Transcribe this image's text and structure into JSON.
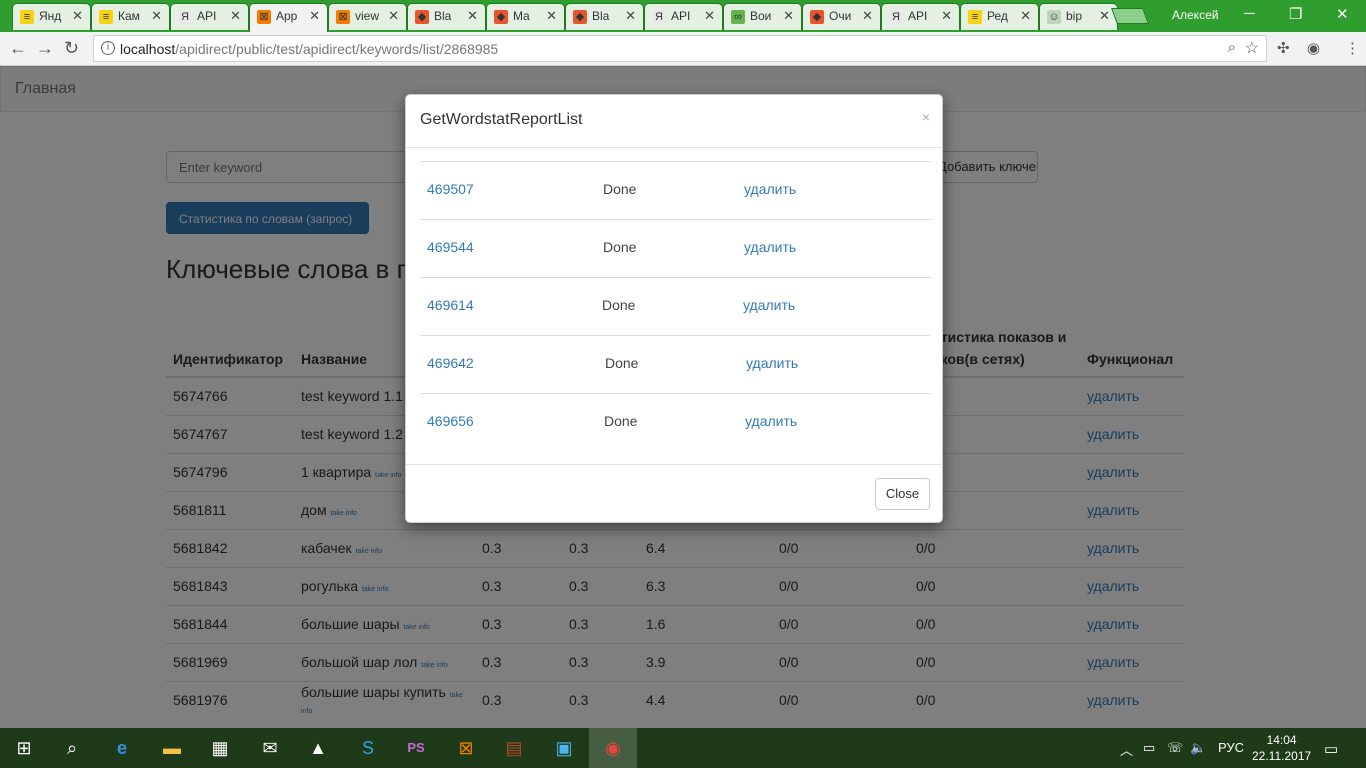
{
  "browser": {
    "tabs": [
      {
        "title": "Янд",
        "fav_color": "#f5d312",
        "fav_text": "≡"
      },
      {
        "title": "Кам",
        "fav_color": "#f5d312",
        "fav_text": "≡"
      },
      {
        "title": "API",
        "fav_color": "#e9e9e9",
        "fav_text": "Я"
      },
      {
        "title": "App",
        "fav_color": "#f57c00",
        "fav_text": "⊠"
      },
      {
        "title": "view",
        "fav_color": "#f57c00",
        "fav_text": "⊠"
      },
      {
        "title": "Bla",
        "fav_color": "#e8542c",
        "fav_text": "◆"
      },
      {
        "title": "Ma",
        "fav_color": "#e8542c",
        "fav_text": "◆"
      },
      {
        "title": "Bla",
        "fav_color": "#e8542c",
        "fav_text": "◆"
      },
      {
        "title": "API",
        "fav_color": "#e9e9e9",
        "fav_text": "Я"
      },
      {
        "title": "Вои",
        "fav_color": "#64b34f",
        "fav_text": "∞"
      },
      {
        "title": "Очи",
        "fav_color": "#e8542c",
        "fav_text": "◆"
      },
      {
        "title": "API",
        "fav_color": "#e9e9e9",
        "fav_text": "Я"
      },
      {
        "title": "Ред",
        "fav_color": "#f5d312",
        "fav_text": "≡"
      },
      {
        "title": "bip",
        "fav_color": "#bcd6bb",
        "fav_text": "☺"
      }
    ],
    "profile_name": "Алексей",
    "url_host": "localhost",
    "url_path": "/apidirect/public/test/apidirect/keywords/list/2868985"
  },
  "page": {
    "brand": "Главная",
    "keyword_placeholder": "Enter keyword",
    "add_keyword_label": "Добавить ключевое слово",
    "stats_button_label": "Статистика по словам (запрос)",
    "heading": "Ключевые слова в группе",
    "table": {
      "headers": [
        "Идентификатор",
        "Название",
        "",
        "",
        "",
        "",
        "Статистика показов и кликов(в сетях)",
        "Функционал"
      ],
      "rows": [
        {
          "id": "5674766",
          "name": "test keyword 1.1",
          "take": "",
          "c3": "",
          "c4": "",
          "c5": "",
          "c6": "",
          "c7": "",
          "action": "удалить"
        },
        {
          "id": "5674767",
          "name": "test keyword 1.2",
          "take": "",
          "c3": "",
          "c4": "",
          "c5": "",
          "c6": "",
          "c7": "",
          "action": "удалить"
        },
        {
          "id": "5674796",
          "name": "1 квартира",
          "take": "take info",
          "c3": "",
          "c4": "",
          "c5": "",
          "c6": "",
          "c7": "",
          "action": "удалить"
        },
        {
          "id": "5681811",
          "name": "дом",
          "take": "take info",
          "c3": "",
          "c4": "",
          "c5": "",
          "c6": "",
          "c7": "",
          "action": "удалить"
        },
        {
          "id": "5681842",
          "name": "кабачек",
          "take": "take info",
          "c3": "0.3",
          "c4": "0.3",
          "c5": "6.4",
          "c6": "0/0",
          "c7": "0/0",
          "action": "удалить"
        },
        {
          "id": "5681843",
          "name": "рогулька",
          "take": "take info",
          "c3": "0.3",
          "c4": "0.3",
          "c5": "6.3",
          "c6": "0/0",
          "c7": "0/0",
          "action": "удалить"
        },
        {
          "id": "5681844",
          "name": "большие шары",
          "take": "take info",
          "c3": "0.3",
          "c4": "0.3",
          "c5": "1.6",
          "c6": "0/0",
          "c7": "0/0",
          "action": "удалить"
        },
        {
          "id": "5681969",
          "name": "большой шар лол",
          "take": "take info",
          "c3": "0.3",
          "c4": "0.3",
          "c5": "3.9",
          "c6": "0/0",
          "c7": "0/0",
          "action": "удалить"
        },
        {
          "id": "5681976",
          "name": "большие шары купить",
          "take": "take info",
          "c3": "0.3",
          "c4": "0.3",
          "c5": "4.4",
          "c6": "0/0",
          "c7": "0/0",
          "action": "удалить"
        }
      ]
    }
  },
  "modal": {
    "title": "GetWordstatReportList",
    "close_x": "×",
    "rows": [
      {
        "id": "469507",
        "status": "Done",
        "action": "удалить"
      },
      {
        "id": "469544",
        "status": "Done",
        "action": "удалить"
      },
      {
        "id": "469614",
        "status": "Done",
        "action": "удалить"
      },
      {
        "id": "469642",
        "status": "Done",
        "action": "удалить"
      },
      {
        "id": "469656",
        "status": "Done",
        "action": "удалить"
      }
    ],
    "close_label": "Close"
  },
  "taskbar": {
    "lang": "РУС",
    "time": "14:04",
    "date": "22.11.2017"
  },
  "colors": {
    "link": "#337ab7",
    "primary_button": "#337ab7",
    "tabstrip": "#2f9e2f",
    "taskbar": "#1e3a18"
  }
}
